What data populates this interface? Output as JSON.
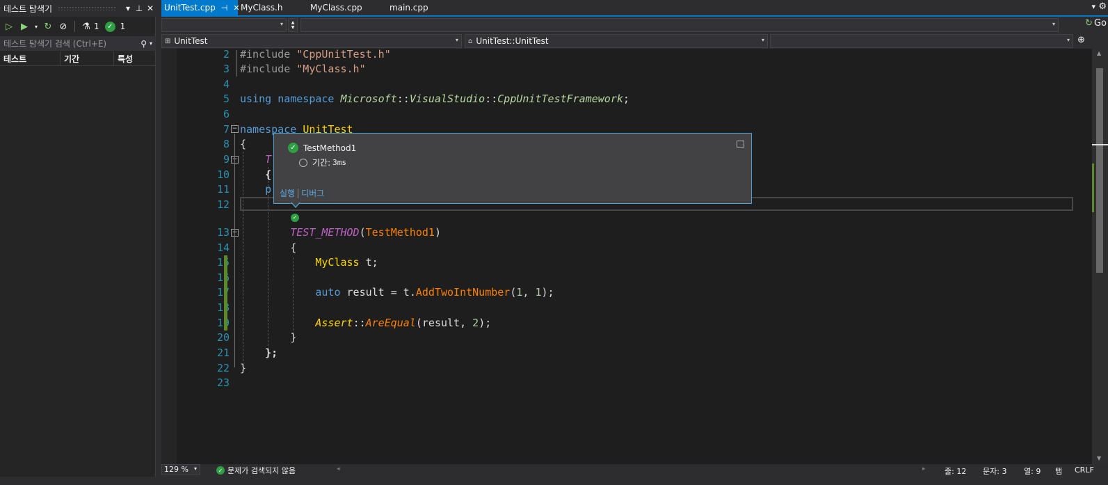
{
  "left_panel": {
    "title": "테스트 탐색기",
    "toolbar": {
      "flask_count": "1",
      "passed_count": "1"
    },
    "search_placeholder": "테스트 탐색기 검색 (Ctrl+E)",
    "columns": [
      "테스트",
      "기간",
      "특성"
    ]
  },
  "tabs": [
    {
      "label": "UnitTest.cpp",
      "active": true
    },
    {
      "label": "MyClass.h"
    },
    {
      "label": "MyClass.cpp"
    },
    {
      "label": "main.cpp"
    }
  ],
  "toolbar": {
    "go_label": "Go"
  },
  "navbar": {
    "project": "UnitTest",
    "scope": "UnitTest::UnitTest"
  },
  "editor": {
    "line_numbers": [
      "2",
      "3",
      "4",
      "5",
      "6",
      "7",
      "8",
      "9",
      "10",
      "11",
      "12",
      "13",
      "14",
      "15",
      "16",
      "17",
      "18",
      "19",
      "20",
      "21",
      "22",
      "23"
    ]
  },
  "codelens_popup": {
    "test_name": "TestMethod1",
    "duration_label": "기간:",
    "duration_value": "3ms",
    "run_link": "실행",
    "debug_link": "디버그"
  },
  "status_bar": {
    "zoom": "129 %",
    "issues": "문제가 검색되지 않음",
    "line": "줄: 12",
    "char": "문자: 3",
    "col": "열: 9",
    "indent": "탭",
    "eol": "CRLF"
  },
  "colors": {
    "accent": "#007acc",
    "pass": "#2ea043",
    "line_number": "#2b91af"
  }
}
